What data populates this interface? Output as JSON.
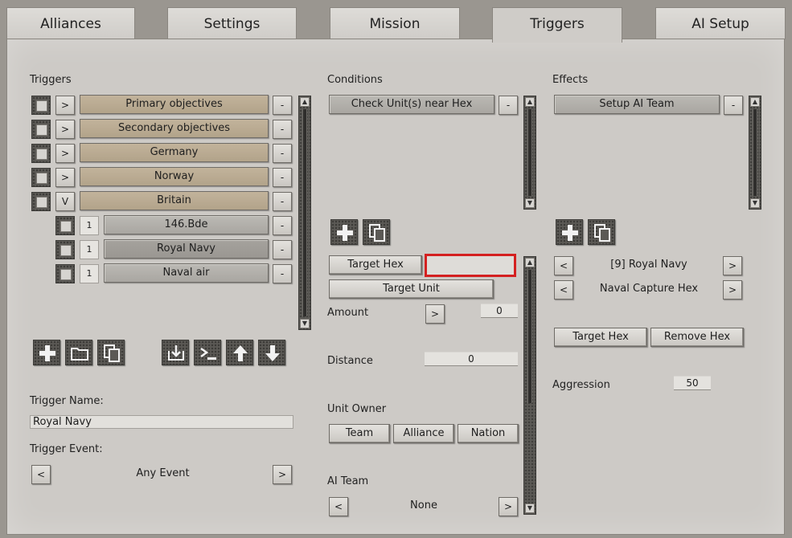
{
  "tabs": [
    "Alliances",
    "Settings",
    "Mission",
    "Triggers",
    "AI Setup"
  ],
  "triggers": {
    "heading": "Triggers",
    "rows": [
      {
        "toggle": ">",
        "label": "Primary objectives",
        "remove": "-"
      },
      {
        "toggle": ">",
        "label": "Secondary objectives",
        "remove": "-"
      },
      {
        "toggle": ">",
        "label": "Germany",
        "remove": "-"
      },
      {
        "toggle": ">",
        "label": "Norway",
        "remove": "-"
      },
      {
        "toggle": "V",
        "label": "Britain",
        "remove": "-"
      }
    ],
    "children": [
      {
        "num": "1",
        "label": "146.Bde",
        "remove": "-"
      },
      {
        "num": "1",
        "label": "Royal Navy",
        "remove": "-"
      },
      {
        "num": "1",
        "label": "Naval air",
        "remove": "-"
      }
    ],
    "trigger_name_label": "Trigger Name:",
    "trigger_name_value": "Royal Navy",
    "trigger_event_label": "Trigger Event:",
    "trigger_event_value": "Any Event",
    "prev": "<",
    "next": ">"
  },
  "conditions": {
    "heading": "Conditions",
    "item": "Check Unit(s) near Hex",
    "remove": "-",
    "target_hex": "Target Hex",
    "target_hex_value": "",
    "target_unit": "Target Unit",
    "amount_label": "Amount",
    "amount_btn": ">",
    "amount_value": "0",
    "distance_label": "Distance",
    "distance_value": "0",
    "unit_owner_label": "Unit Owner",
    "owner_team": "Team",
    "owner_alliance": "Alliance",
    "owner_nation": "Nation",
    "ai_team_label": "AI Team",
    "ai_team_value": "None",
    "prev": "<",
    "next": ">"
  },
  "effects": {
    "heading": "Effects",
    "item": "Setup AI Team",
    "remove": "-",
    "team_value": "[9] Royal Navy",
    "hex_value": "Naval Capture Hex",
    "prev": "<",
    "next": ">",
    "target_hex": "Target Hex",
    "remove_hex": "Remove Hex",
    "aggression_label": "Aggression",
    "aggression_value": "50"
  },
  "colors": {
    "panel": "#cdcac6",
    "trigger_group": "#b8a990",
    "highlight_box": "#d42020"
  },
  "icons": [
    "plus-icon",
    "folder-icon",
    "copy-icon",
    "import-icon",
    "console-icon",
    "arrow-up-icon",
    "arrow-down-icon"
  ]
}
